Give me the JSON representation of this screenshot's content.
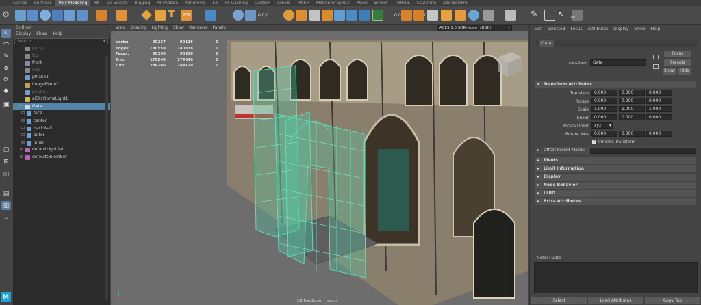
{
  "shelf": {
    "tabs": [
      "Curves",
      "Surfaces",
      "Poly Modeling",
      "XK",
      "UV Editing",
      "Rigging",
      "Animation",
      "Rendering",
      "FX",
      "FX Caching",
      "Custom",
      "Arnold",
      "MASH",
      "Motion Graphics",
      "XGen",
      "Bifrost",
      "TURTLE",
      "Sculpting",
      "ZooToolsPro"
    ],
    "active_tab": "Poly Modeling",
    "counter": "0,0,0",
    "field_a": "0.00",
    "field_b": "1.00",
    "colorspace": "ACES 1.0 SDR-video (sRGB)",
    "set_label": "Set"
  },
  "outliner": {
    "title": "Outliner",
    "menu": [
      "Display",
      "Show",
      "Help"
    ],
    "search_placeholder": "Search...",
    "items": [
      {
        "label": "persp",
        "dim": true,
        "indent": 0
      },
      {
        "label": "top",
        "dim": true,
        "indent": 0
      },
      {
        "label": "front",
        "dim": false,
        "indent": 0
      },
      {
        "label": "side",
        "dim": true,
        "indent": 0
      },
      {
        "label": "pPlane1",
        "dim": false,
        "indent": 0
      },
      {
        "label": "imagePlane1",
        "dim": false,
        "indent": 0
      },
      {
        "label": "pCube1",
        "dim": true,
        "indent": 0
      },
      {
        "label": "aiSkyDomeLight1",
        "dim": false,
        "indent": 0
      },
      {
        "label": "Gate",
        "dim": false,
        "indent": 0,
        "selected": true
      },
      {
        "label": "face",
        "dim": false,
        "indent": 1
      },
      {
        "label": "center",
        "dim": false,
        "indent": 1
      },
      {
        "label": "backWall",
        "dim": false,
        "indent": 1
      },
      {
        "label": "outer",
        "dim": false,
        "indent": 1
      },
      {
        "label": "inner",
        "dim": false,
        "indent": 1
      },
      {
        "label": "defaultLightSet",
        "dim": false,
        "indent": 0
      },
      {
        "label": "defaultObjectSet",
        "dim": false,
        "indent": 0
      }
    ]
  },
  "viewport": {
    "menu": [
      "View",
      "Shading",
      "Lighting",
      "Show",
      "Renderer",
      "Panels"
    ],
    "hud": [
      {
        "label": "Verts:",
        "a": "90237",
        "b": "90116",
        "c": "0"
      },
      {
        "label": "Edges:",
        "a": "180558",
        "b": "180338",
        "c": "0"
      },
      {
        "label": "Faces:",
        "a": "90390",
        "b": "90290",
        "c": "0"
      },
      {
        "label": "Tris:",
        "a": "179840",
        "b": "179640",
        "c": "0"
      },
      {
        "label": "UVs:",
        "a": "284260",
        "b": "284129",
        "c": "0"
      }
    ],
    "camera_label": "2D Pan/Zoom : persp"
  },
  "attribute_editor": {
    "menu": [
      "List",
      "Selected",
      "Focus",
      "Attributes",
      "Display",
      "Show",
      "Help"
    ],
    "node_tab": "Gate",
    "transform_label": "transform",
    "transform_value": "Gate",
    "buttons": {
      "focus": "Focus",
      "presets": "Presets",
      "show": "Show",
      "hide": "Hide"
    },
    "transform_section": "Transform Attributes",
    "rows": [
      {
        "label": "Translate",
        "v": [
          "0.000",
          "0.000",
          "0.000"
        ]
      },
      {
        "label": "Rotate",
        "v": [
          "0.000",
          "0.000",
          "0.000"
        ]
      },
      {
        "label": "Scale",
        "v": [
          "1.000",
          "1.000",
          "1.000"
        ]
      },
      {
        "label": "Shear",
        "v": [
          "0.000",
          "0.000",
          "0.000"
        ]
      }
    ],
    "rotate_order_label": "Rotate Order",
    "rotate_order_value": "xyz",
    "rotate_axis_label": "Rotate Axis",
    "rotate_axis": [
      "0.000",
      "0.000",
      "0.000"
    ],
    "inherits_transform": "Inherits Transform",
    "offset_parent_matrix": "Offset Parent Matrix",
    "sections": [
      "Pivots",
      "Limit Information",
      "Display",
      "Node Behavior",
      "UUID",
      "Extra Attributes"
    ],
    "notes_label": "Notes: Gate",
    "bottom_buttons": [
      "Select",
      "Load Attributes",
      "Copy Tab"
    ]
  }
}
